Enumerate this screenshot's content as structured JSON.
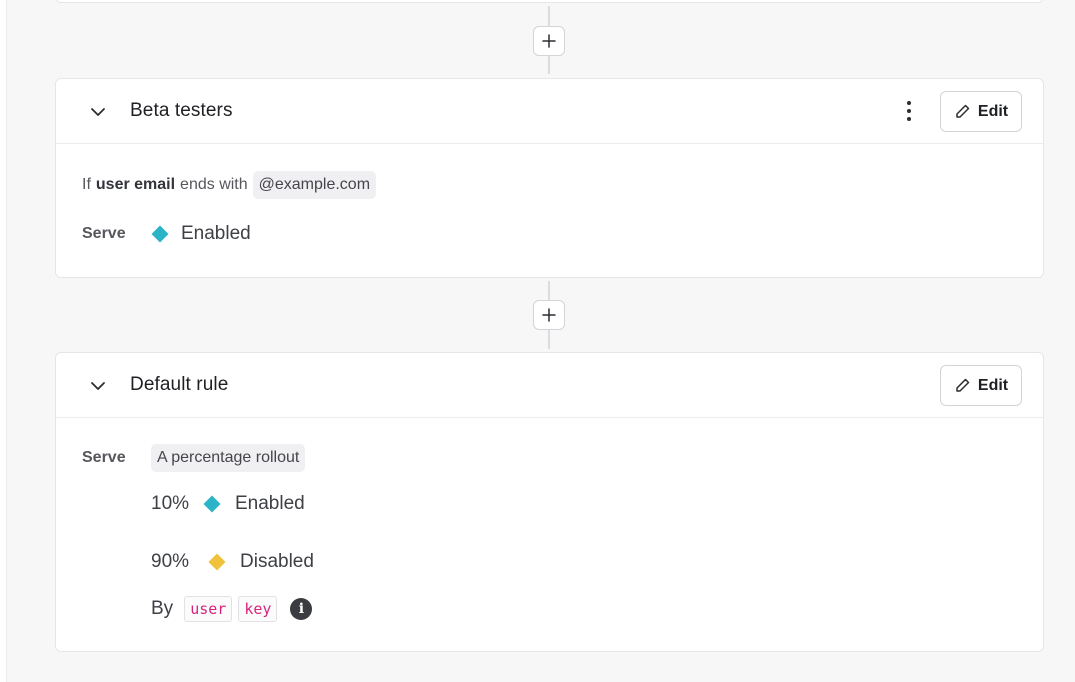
{
  "colors": {
    "enabled": "#2bb3c8",
    "disabled": "#f0c23b",
    "code": "#d6247d"
  },
  "add_rule_icon": "plus-icon",
  "beta_rule": {
    "title": "Beta testers",
    "edit_label": "Edit",
    "condition": {
      "prefix": "If",
      "attribute": "user email",
      "operator": "ends with",
      "value": "@example.com"
    },
    "serve_label": "Serve",
    "serve_variation": "Enabled"
  },
  "default_rule": {
    "title": "Default rule",
    "edit_label": "Edit",
    "serve_label": "Serve",
    "serve_mode": "A percentage rollout",
    "rollout": [
      {
        "percent": "10%",
        "variation": "Enabled"
      },
      {
        "percent": "90%",
        "variation": "Disabled"
      }
    ],
    "by_label": "By",
    "by_context": "user",
    "by_attribute": "key"
  }
}
